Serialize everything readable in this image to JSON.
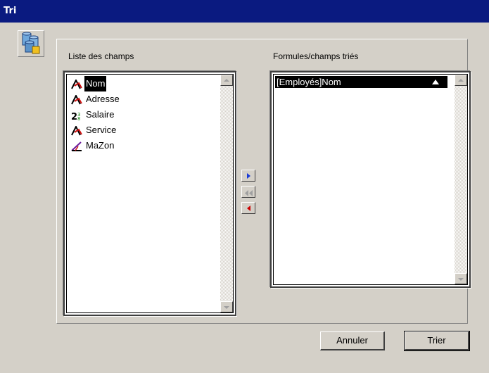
{
  "window": {
    "title": "Tri"
  },
  "icons": {
    "app": "sort-database-icon"
  },
  "left_panel": {
    "label": "Liste des champs",
    "items": [
      {
        "label": "Nom",
        "icon": "text-field-icon",
        "selected": true
      },
      {
        "label": "Adresse",
        "icon": "text-field-icon",
        "selected": false
      },
      {
        "label": "Salaire",
        "icon": "numeric-field-icon",
        "selected": false
      },
      {
        "label": "Service",
        "icon": "text-field-icon",
        "selected": false
      },
      {
        "label": "MaZon",
        "icon": "formula-field-icon",
        "selected": false
      }
    ]
  },
  "right_panel": {
    "label": "Formules/champs triés",
    "items": [
      {
        "label": "[Employés]Nom",
        "sort_order": "ascending",
        "selected": true
      }
    ]
  },
  "buttons": {
    "cancel": "Annuler",
    "sort": "Trier"
  },
  "colors": {
    "titlebar": "#0a1a80",
    "dialog": "#d4d0c8",
    "add_arrow": "#1a3cd8",
    "remove_arrow": "#cc0000"
  }
}
